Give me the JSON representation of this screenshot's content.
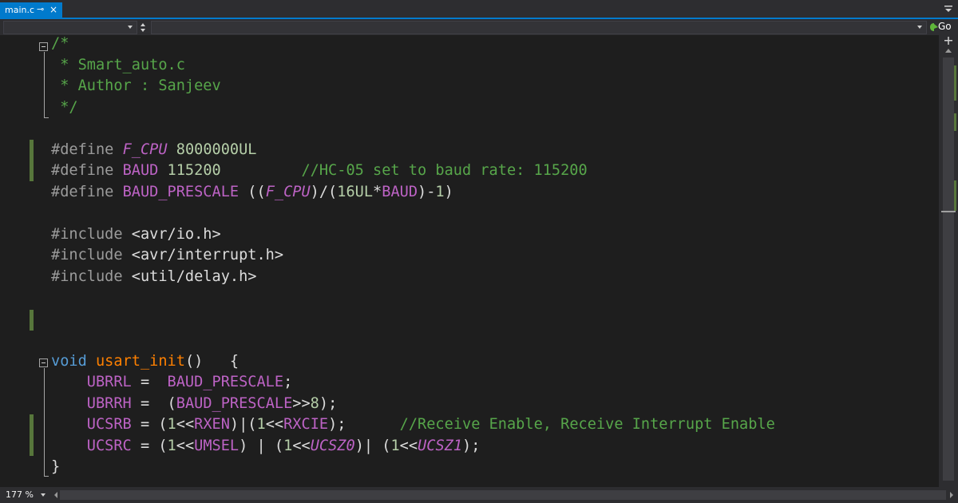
{
  "tab": {
    "title": "main.c",
    "pin_icon": "pin-icon",
    "close_icon": "close-icon",
    "accent": "#007acc"
  },
  "navbar": {
    "go_label": "Go"
  },
  "zoom": {
    "level": "177 %"
  },
  "code_lines": [
    [
      [
        "c-comment",
        "/*"
      ]
    ],
    [
      [
        "c-comment",
        " * Smart_auto.c"
      ]
    ],
    [
      [
        "c-comment",
        " * Author : Sanjeev"
      ]
    ],
    [
      [
        "c-comment",
        " */"
      ]
    ],
    [],
    [
      [
        "c-pre",
        "#define "
      ],
      [
        "c-macro-i",
        "F_CPU"
      ],
      [
        "c-plain",
        " "
      ],
      [
        "c-num",
        "8000000UL"
      ]
    ],
    [
      [
        "c-pre",
        "#define "
      ],
      [
        "c-macro",
        "BAUD"
      ],
      [
        "c-plain",
        " "
      ],
      [
        "c-num",
        "115200"
      ],
      [
        "c-plain",
        "         "
      ],
      [
        "c-comment",
        "//HC-05 set to baud rate: 115200"
      ]
    ],
    [
      [
        "c-pre",
        "#define "
      ],
      [
        "c-macro",
        "BAUD_PRESCALE"
      ],
      [
        "c-plain",
        " (("
      ],
      [
        "c-macro-i",
        "F_CPU"
      ],
      [
        "c-plain",
        ")/("
      ],
      [
        "c-num",
        "16UL"
      ],
      [
        "c-plain",
        "*"
      ],
      [
        "c-macro",
        "BAUD"
      ],
      [
        "c-plain",
        ")-"
      ],
      [
        "c-num",
        "1"
      ],
      [
        "c-plain",
        ")"
      ]
    ],
    [],
    [
      [
        "c-pre",
        "#include "
      ],
      [
        "c-plain",
        "<avr/io.h>"
      ]
    ],
    [
      [
        "c-pre",
        "#include "
      ],
      [
        "c-plain",
        "<avr/interrupt.h>"
      ]
    ],
    [
      [
        "c-pre",
        "#include "
      ],
      [
        "c-plain",
        "<util/delay.h>"
      ]
    ],
    [],
    [],
    [],
    [
      [
        "c-kw",
        "void"
      ],
      [
        "c-plain",
        " "
      ],
      [
        "c-fn",
        "usart_init"
      ],
      [
        "c-plain",
        "()   {"
      ]
    ],
    [
      [
        "c-plain",
        "    "
      ],
      [
        "c-macro",
        "UBRRL"
      ],
      [
        "c-plain",
        " =  "
      ],
      [
        "c-macro",
        "BAUD_PRESCALE"
      ],
      [
        "c-plain",
        ";"
      ]
    ],
    [
      [
        "c-plain",
        "    "
      ],
      [
        "c-macro",
        "UBRRH"
      ],
      [
        "c-plain",
        " =  ("
      ],
      [
        "c-macro",
        "BAUD_PRESCALE"
      ],
      [
        "c-plain",
        ">>"
      ],
      [
        "c-num",
        "8"
      ],
      [
        "c-plain",
        ");"
      ]
    ],
    [
      [
        "c-plain",
        "    "
      ],
      [
        "c-macro",
        "UCSRB"
      ],
      [
        "c-plain",
        " = ("
      ],
      [
        "c-num",
        "1"
      ],
      [
        "c-plain",
        "<<"
      ],
      [
        "c-macro",
        "RXEN"
      ],
      [
        "c-plain",
        ")|("
      ],
      [
        "c-num",
        "1"
      ],
      [
        "c-plain",
        "<<"
      ],
      [
        "c-macro",
        "RXCIE"
      ],
      [
        "c-plain",
        ");      "
      ],
      [
        "c-comment",
        "//Receive Enable, Receive Interrupt Enable"
      ]
    ],
    [
      [
        "c-plain",
        "    "
      ],
      [
        "c-macro",
        "UCSRC"
      ],
      [
        "c-plain",
        " = ("
      ],
      [
        "c-num",
        "1"
      ],
      [
        "c-plain",
        "<<"
      ],
      [
        "c-macro",
        "UMSEL"
      ],
      [
        "c-plain",
        ") | ("
      ],
      [
        "c-num",
        "1"
      ],
      [
        "c-plain",
        "<<"
      ],
      [
        "c-macro-i",
        "UCSZ0"
      ],
      [
        "c-plain",
        ")| ("
      ],
      [
        "c-num",
        "1"
      ],
      [
        "c-plain",
        "<<"
      ],
      [
        "c-macro-i",
        "UCSZ1"
      ],
      [
        "c-plain",
        ");"
      ]
    ],
    [
      [
        "c-plain",
        "}"
      ]
    ]
  ],
  "colors": {
    "comment": "#57a64a",
    "preprocessor": "#9b9b9b",
    "macro": "#bd63c5",
    "number": "#b5cea8",
    "keyword": "#569cd6",
    "function": "#ff8000",
    "change_marker": "#57763b"
  }
}
